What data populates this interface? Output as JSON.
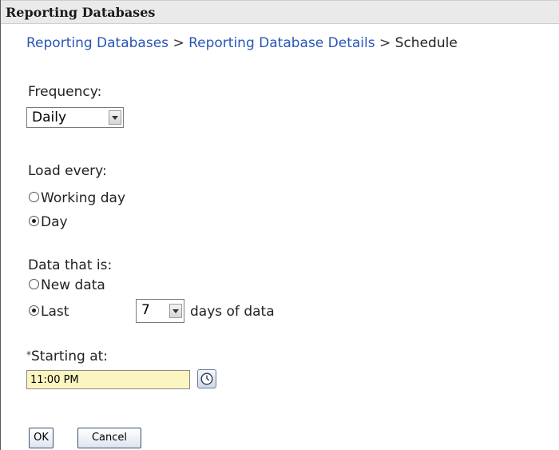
{
  "window": {
    "title": "Reporting Databases"
  },
  "breadcrumb": {
    "items": [
      "Reporting Databases",
      "Reporting Database Details"
    ],
    "separator": ">",
    "current": "Schedule"
  },
  "frequency": {
    "label": "Frequency:",
    "value": "Daily"
  },
  "load_every": {
    "label": "Load every:",
    "options": [
      {
        "label": "Working day",
        "checked": false
      },
      {
        "label": "Day",
        "checked": true
      }
    ]
  },
  "data_that_is": {
    "label": "Data that is:",
    "options": [
      {
        "label": "New data",
        "checked": false
      },
      {
        "label": "Last",
        "checked": true
      }
    ],
    "days_value": "7",
    "days_suffix": "days of data"
  },
  "starting_at": {
    "required_marker": "*",
    "label": "Starting at:",
    "value": "11:00 PM",
    "clock_icon": "clock-icon"
  },
  "actions": {
    "ok_label": "OK",
    "cancel_label": "Cancel"
  },
  "colors": {
    "link": "#2a55b6",
    "input_highlight": "#fbf5c0",
    "titlebar_bg": "#eaeaea"
  }
}
